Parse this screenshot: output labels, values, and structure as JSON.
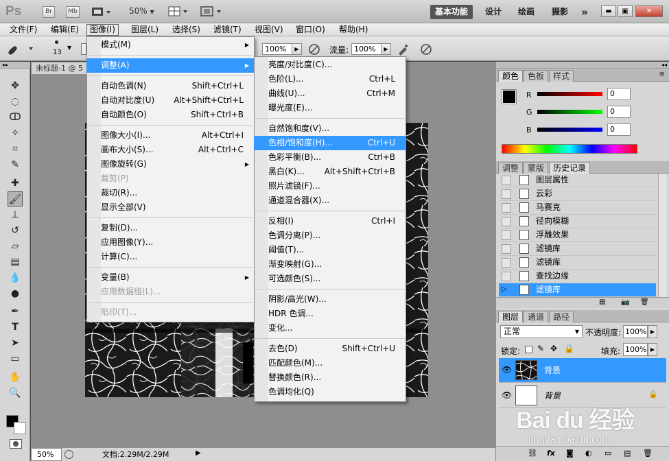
{
  "app": {
    "logo": "Ps",
    "bridge_btn": "Br",
    "minibridge_btn": "Mb",
    "zoom": "50%",
    "workspaces": [
      "基本功能",
      "设计",
      "绘画",
      "摄影"
    ],
    "more": "»",
    "win_min": "▬",
    "win_max": "▣",
    "win_close": "✕"
  },
  "menubar": [
    "文件(F)",
    "编辑(E)",
    "图像(I)",
    "图层(L)",
    "选择(S)",
    "滤镜(T)",
    "视图(V)",
    "窗口(O)",
    "帮助(H)"
  ],
  "options": {
    "brush_size": "13",
    "opacity_value": "100%",
    "flow_label": "流量:",
    "flow_value": "100%"
  },
  "document": {
    "tab_title": "未标题-1 @ 5",
    "status_zoom": "50%",
    "status_doc": "文档:2.29M/2.29M"
  },
  "image_menu": {
    "items": [
      {
        "label": "模式(M)",
        "shortcut": "",
        "submenu": true,
        "state": "normal"
      },
      {
        "sep": true
      },
      {
        "label": "调整(A)",
        "shortcut": "",
        "submenu": true,
        "state": "highlight"
      },
      {
        "sep": true
      },
      {
        "label": "自动色调(N)",
        "shortcut": "Shift+Ctrl+L",
        "state": "normal"
      },
      {
        "label": "自动对比度(U)",
        "shortcut": "Alt+Shift+Ctrl+L",
        "state": "normal"
      },
      {
        "label": "自动颜色(O)",
        "shortcut": "Shift+Ctrl+B",
        "state": "normal"
      },
      {
        "sep": true
      },
      {
        "label": "图像大小(I)...",
        "shortcut": "Alt+Ctrl+I",
        "state": "normal"
      },
      {
        "label": "画布大小(S)...",
        "shortcut": "Alt+Ctrl+C",
        "state": "normal"
      },
      {
        "label": "图像旋转(G)",
        "shortcut": "",
        "submenu": true,
        "state": "normal"
      },
      {
        "label": "裁剪(P)",
        "shortcut": "",
        "state": "disabled"
      },
      {
        "label": "裁切(R)...",
        "shortcut": "",
        "state": "normal"
      },
      {
        "label": "显示全部(V)",
        "shortcut": "",
        "state": "normal"
      },
      {
        "sep": true
      },
      {
        "label": "复制(D)...",
        "shortcut": "",
        "state": "normal"
      },
      {
        "label": "应用图像(Y)...",
        "shortcut": "",
        "state": "normal"
      },
      {
        "label": "计算(C)...",
        "shortcut": "",
        "state": "normal"
      },
      {
        "sep": true
      },
      {
        "label": "变量(B)",
        "shortcut": "",
        "submenu": true,
        "state": "normal"
      },
      {
        "label": "应用数据组(L)...",
        "shortcut": "",
        "state": "disabled"
      },
      {
        "sep": true
      },
      {
        "label": "陷印(T)...",
        "shortcut": "",
        "state": "disabled"
      }
    ]
  },
  "adjust_menu": {
    "items": [
      {
        "label": "亮度/对比度(C)...",
        "shortcut": "",
        "state": "normal"
      },
      {
        "label": "色阶(L)...",
        "shortcut": "Ctrl+L",
        "state": "normal"
      },
      {
        "label": "曲线(U)...",
        "shortcut": "Ctrl+M",
        "state": "normal"
      },
      {
        "label": "曝光度(E)...",
        "shortcut": "",
        "state": "normal"
      },
      {
        "sep": true
      },
      {
        "label": "自然饱和度(V)...",
        "shortcut": "",
        "state": "normal"
      },
      {
        "label": "色相/饱和度(H)...",
        "shortcut": "Ctrl+U",
        "state": "highlight"
      },
      {
        "label": "色彩平衡(B)...",
        "shortcut": "Ctrl+B",
        "state": "normal"
      },
      {
        "label": "黑白(K)...",
        "shortcut": "Alt+Shift+Ctrl+B",
        "state": "normal"
      },
      {
        "label": "照片滤镜(F)...",
        "shortcut": "",
        "state": "normal"
      },
      {
        "label": "通道混合器(X)...",
        "shortcut": "",
        "state": "normal"
      },
      {
        "sep": true
      },
      {
        "label": "反相(I)",
        "shortcut": "Ctrl+I",
        "state": "normal"
      },
      {
        "label": "色调分离(P)...",
        "shortcut": "",
        "state": "normal"
      },
      {
        "label": "阈值(T)...",
        "shortcut": "",
        "state": "normal"
      },
      {
        "label": "渐变映射(G)...",
        "shortcut": "",
        "state": "normal"
      },
      {
        "label": "可选颜色(S)...",
        "shortcut": "",
        "state": "normal"
      },
      {
        "sep": true
      },
      {
        "label": "阴影/高光(W)...",
        "shortcut": "",
        "state": "normal"
      },
      {
        "label": "HDR 色调...",
        "shortcut": "",
        "state": "normal"
      },
      {
        "label": "变化...",
        "shortcut": "",
        "state": "normal"
      },
      {
        "sep": true
      },
      {
        "label": "去色(D)",
        "shortcut": "Shift+Ctrl+U",
        "state": "normal"
      },
      {
        "label": "匹配颜色(M)...",
        "shortcut": "",
        "state": "normal"
      },
      {
        "label": "替换颜色(R)...",
        "shortcut": "",
        "state": "normal"
      },
      {
        "label": "色调均化(Q)",
        "shortcut": "",
        "state": "normal"
      }
    ]
  },
  "color_panel": {
    "tabs": [
      "颜色",
      "色板",
      "样式"
    ],
    "channels": [
      {
        "label": "R",
        "value": "0",
        "color": "#ff0000"
      },
      {
        "label": "G",
        "value": "0",
        "color": "#00ff00"
      },
      {
        "label": "B",
        "value": "0",
        "color": "#0000ff"
      }
    ]
  },
  "history_panel": {
    "tabs": [
      "调整",
      "蒙版",
      "历史记录"
    ],
    "items": [
      "图层属性",
      "云彩",
      "马赛克",
      "径向模糊",
      "浮雕效果",
      "滤镜库",
      "滤镜库",
      "查找边缘",
      "滤镜库"
    ],
    "selected": 8
  },
  "layers_panel": {
    "tabs": [
      "图层",
      "通道",
      "路径"
    ],
    "blend_mode": "正常",
    "opacity_label": "不透明度:",
    "opacity_value": "100%",
    "lock_label": "锁定:",
    "fill_label": "填充:",
    "fill_value": "100%",
    "layers": [
      {
        "name": "背景",
        "selected": true
      },
      {
        "name": "背景",
        "selected": false,
        "italic": true
      }
    ]
  },
  "watermark": {
    "logo": "Bai du 经验",
    "url": "jingyan.baidu.com"
  },
  "colors": {
    "highlight": "#3399ff"
  }
}
